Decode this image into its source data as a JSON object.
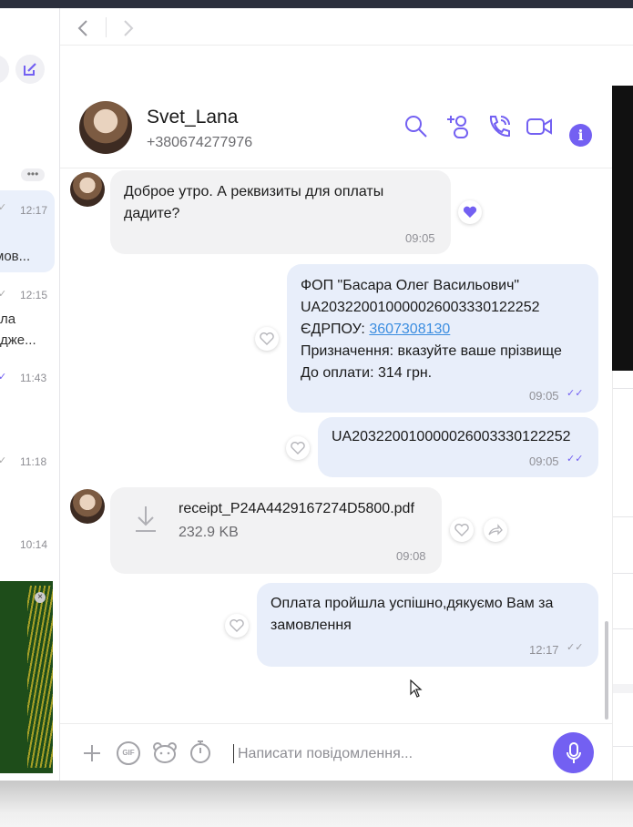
{
  "contact": {
    "name": "Svet_Lana",
    "phone": "+380674277976"
  },
  "chat_list": {
    "items": [
      {
        "time": "12:17",
        "preview": "мов..."
      },
      {
        "time": "12:15",
        "preview_line1": "ла",
        "preview_line2": "дже..."
      },
      {
        "time": "11:43"
      },
      {
        "time": "11:18"
      },
      {
        "time": "10:14"
      }
    ]
  },
  "messages": [
    {
      "direction": "in",
      "text_line1": "Доброе утро. А реквизиты для оплаты",
      "text_line2": "дадите?",
      "time": "09:05",
      "reaction": "heart-filled"
    },
    {
      "direction": "out",
      "lines": [
        "ФОП \"Басара Олег Васильович\"",
        "UA203220010000026003330122252",
        "ЄДРПОУ: ",
        "Призначення: вказуйте ваше прізвище",
        "До оплати: 314 грн."
      ],
      "link": "3607308130",
      "time": "09:05"
    },
    {
      "direction": "out",
      "text": "UA203220010000026003330122252",
      "time": "09:05"
    },
    {
      "direction": "in",
      "file_name": "receipt_P24A4429167274D5800.pdf",
      "file_size": "232.9 KB",
      "time": "09:08"
    },
    {
      "direction": "out",
      "text_line1": "Оплата пройшла успішно,дякуємо Вам за",
      "text_line2": "замовлення",
      "time": "12:17"
    }
  ],
  "composer": {
    "placeholder": "Написати повідомлення..."
  },
  "colors": {
    "accent": "#7360f2",
    "bubble_out": "#e8eefa",
    "bubble_in": "#f2f2f3"
  }
}
